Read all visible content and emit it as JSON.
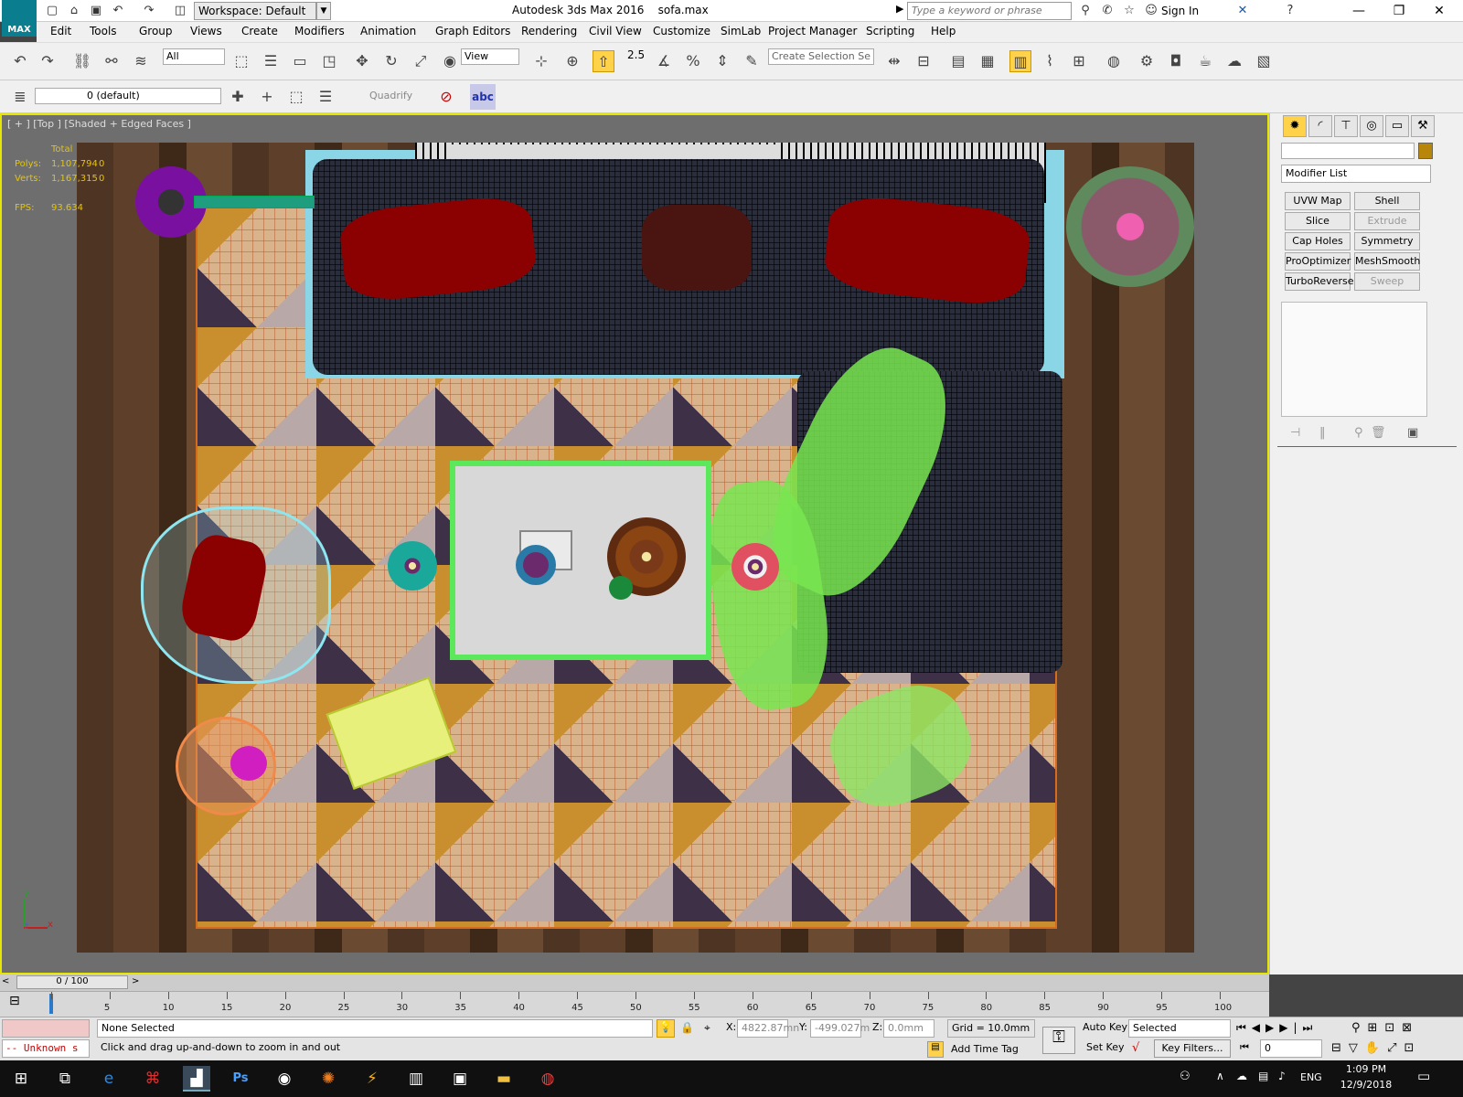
{
  "titlebar": {
    "app_icon_label": "MAX",
    "workspace": "Workspace: Default",
    "app_title": "Autodesk 3ds Max 2016",
    "file_name": "sofa.max",
    "search_placeholder": "Type a keyword or phrase",
    "sign_in": "Sign In"
  },
  "menu": [
    "Edit",
    "Tools",
    "Group",
    "Views",
    "Create",
    "Modifiers",
    "Animation",
    "Graph Editors",
    "Rendering",
    "Civil View",
    "Customize",
    "SimLab",
    "Project Manager",
    "Scripting",
    "Help"
  ],
  "toolbar1": {
    "selection_filter": "All",
    "ref_coord": "View",
    "create_selection_set": "Create Selection Se",
    "snap_value": "2.5"
  },
  "toolbar2": {
    "layer": "0 (default)",
    "quadrify": "Quadrify",
    "abc": "abc"
  },
  "viewport": {
    "label": "[ + ] [Top ] [Shaded + Edged Faces ]",
    "stats": {
      "total_label": "Total",
      "polys_label": "Polys:",
      "polys_value": "1,107,794",
      "polys_sel": "0",
      "verts_label": "Verts:",
      "verts_value": "1,167,315",
      "verts_sel": "0",
      "fps_label": "FPS:",
      "fps_value": "93.634"
    },
    "axis": {
      "x": "x",
      "y": "y",
      "z": "z"
    }
  },
  "command_panel": {
    "modifier_list": "Modifier List",
    "modifiers": [
      {
        "label": "UVW Map",
        "enabled": true
      },
      {
        "label": "Shell",
        "enabled": true
      },
      {
        "label": "Slice",
        "enabled": true
      },
      {
        "label": "Extrude",
        "enabled": false
      },
      {
        "label": "Cap Holes",
        "enabled": true
      },
      {
        "label": "Symmetry",
        "enabled": true
      },
      {
        "label": "ProOptimizer",
        "enabled": true
      },
      {
        "label": "MeshSmooth",
        "enabled": true
      },
      {
        "label": "TurboReverse",
        "enabled": true
      },
      {
        "label": "Sweep",
        "enabled": false
      }
    ]
  },
  "timeline": {
    "frame_counter": "0 / 100",
    "ticks": [
      "0",
      "5",
      "10",
      "15",
      "20",
      "25",
      "30",
      "35",
      "40",
      "45",
      "50",
      "55",
      "60",
      "65",
      "70",
      "75",
      "80",
      "85",
      "90",
      "95",
      "100"
    ]
  },
  "status": {
    "maxscript": "-- Unknown s",
    "selection": "None Selected",
    "prompt": "Click and drag up-and-down to zoom in and out",
    "x_label": "X:",
    "x_value": "4822.87mn",
    "y_label": "Y:",
    "y_value": "-499.027m",
    "z_label": "Z:",
    "z_value": "0.0mm",
    "grid": "Grid = 10.0mm",
    "add_time_tag": "Add Time Tag",
    "auto_key": "Auto Key",
    "set_key": "Set Key",
    "key_mode": "Selected",
    "key_filters": "Key Filters...",
    "frame_value": "0"
  },
  "taskbar": {
    "time": "1:09 PM",
    "date": "12/9/2018",
    "language": "ENG"
  }
}
